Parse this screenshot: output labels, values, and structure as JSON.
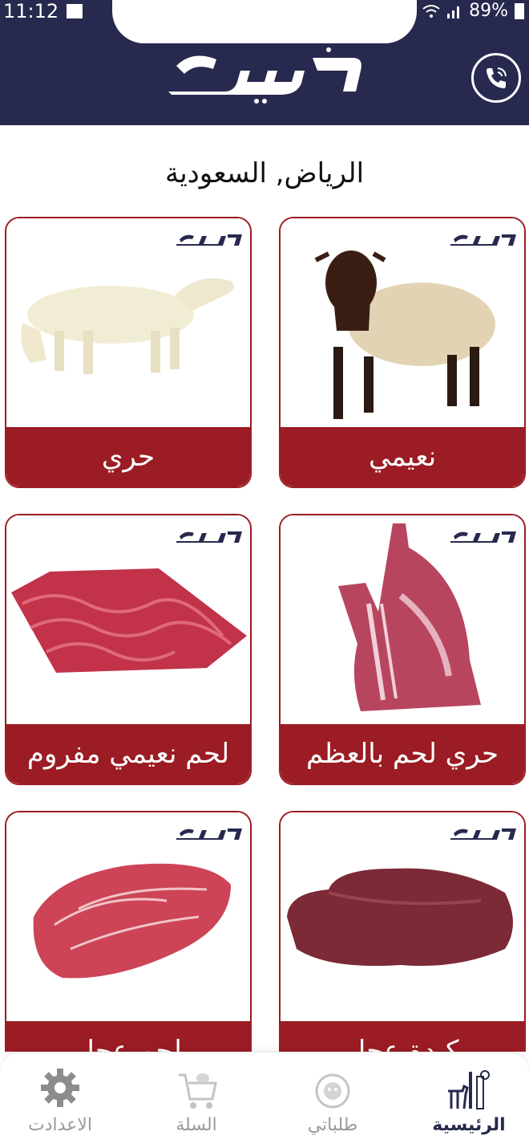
{
  "status_bar": {
    "time": "11:12",
    "battery": "89%"
  },
  "header": {
    "logo_text": "ذبيحة",
    "call_icon": "phone-call-icon"
  },
  "location": {
    "text": "الرياض, السعودية"
  },
  "products": [
    {
      "label": "نعيمي"
    },
    {
      "label": "حري"
    },
    {
      "label": "حري لحم بالعظم"
    },
    {
      "label": "لحم نعيمي مفروم"
    },
    {
      "label": "كبدة عجل"
    },
    {
      "label": "لحم عجل"
    }
  ],
  "nav": {
    "home": "الرئيسية",
    "orders": "طلباتي",
    "cart": "السلة",
    "settings": "الاعدادت"
  },
  "colors": {
    "header": "#272a4e",
    "accent": "#9b1c24"
  }
}
